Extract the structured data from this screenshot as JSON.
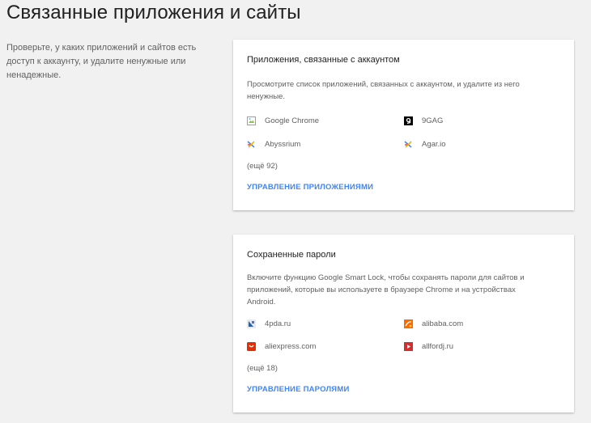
{
  "page": {
    "title": "Связанные приложения и сайты",
    "intro": "Проверьте, у каких приложений и сайтов есть доступ к аккаунту, и удалите ненужные или ненадежные."
  },
  "apps_card": {
    "title": "Приложения, связанные с аккаунтом",
    "description": "Просмотрите список приложений, связанных с аккаунтом, и удалите из него ненужные.",
    "items": [
      {
        "name": "Google Chrome",
        "icon": "broken-image-icon"
      },
      {
        "name": "9GAG",
        "icon": "9gag-icon"
      },
      {
        "name": "Abyssrium",
        "icon": "puzzle-icon"
      },
      {
        "name": "Agar.io",
        "icon": "puzzle-icon"
      }
    ],
    "more": "(ещё 92)",
    "manage_label": "УПРАВЛЕНИЕ ПРИЛОЖЕНИЯМИ"
  },
  "passwords_card": {
    "title": "Сохраненные пароли",
    "description": "Включите функцию Google Smart Lock, чтобы сохранять пароли для сайтов и приложений, которые вы используете в браузере Chrome и на устройствах Android.",
    "items": [
      {
        "name": "4pda.ru",
        "icon": "4pda-icon"
      },
      {
        "name": "alibaba.com",
        "icon": "alibaba-icon"
      },
      {
        "name": "aliexpress.com",
        "icon": "aliexpress-icon"
      },
      {
        "name": "allfordj.ru",
        "icon": "allfordj-icon"
      }
    ],
    "more": "(ещё 18)",
    "manage_label": "УПРАВЛЕНИЕ ПАРОЛЯМИ"
  },
  "colors": {
    "accent": "#4285f4",
    "background": "#f1f1f1",
    "card": "#ffffff"
  }
}
